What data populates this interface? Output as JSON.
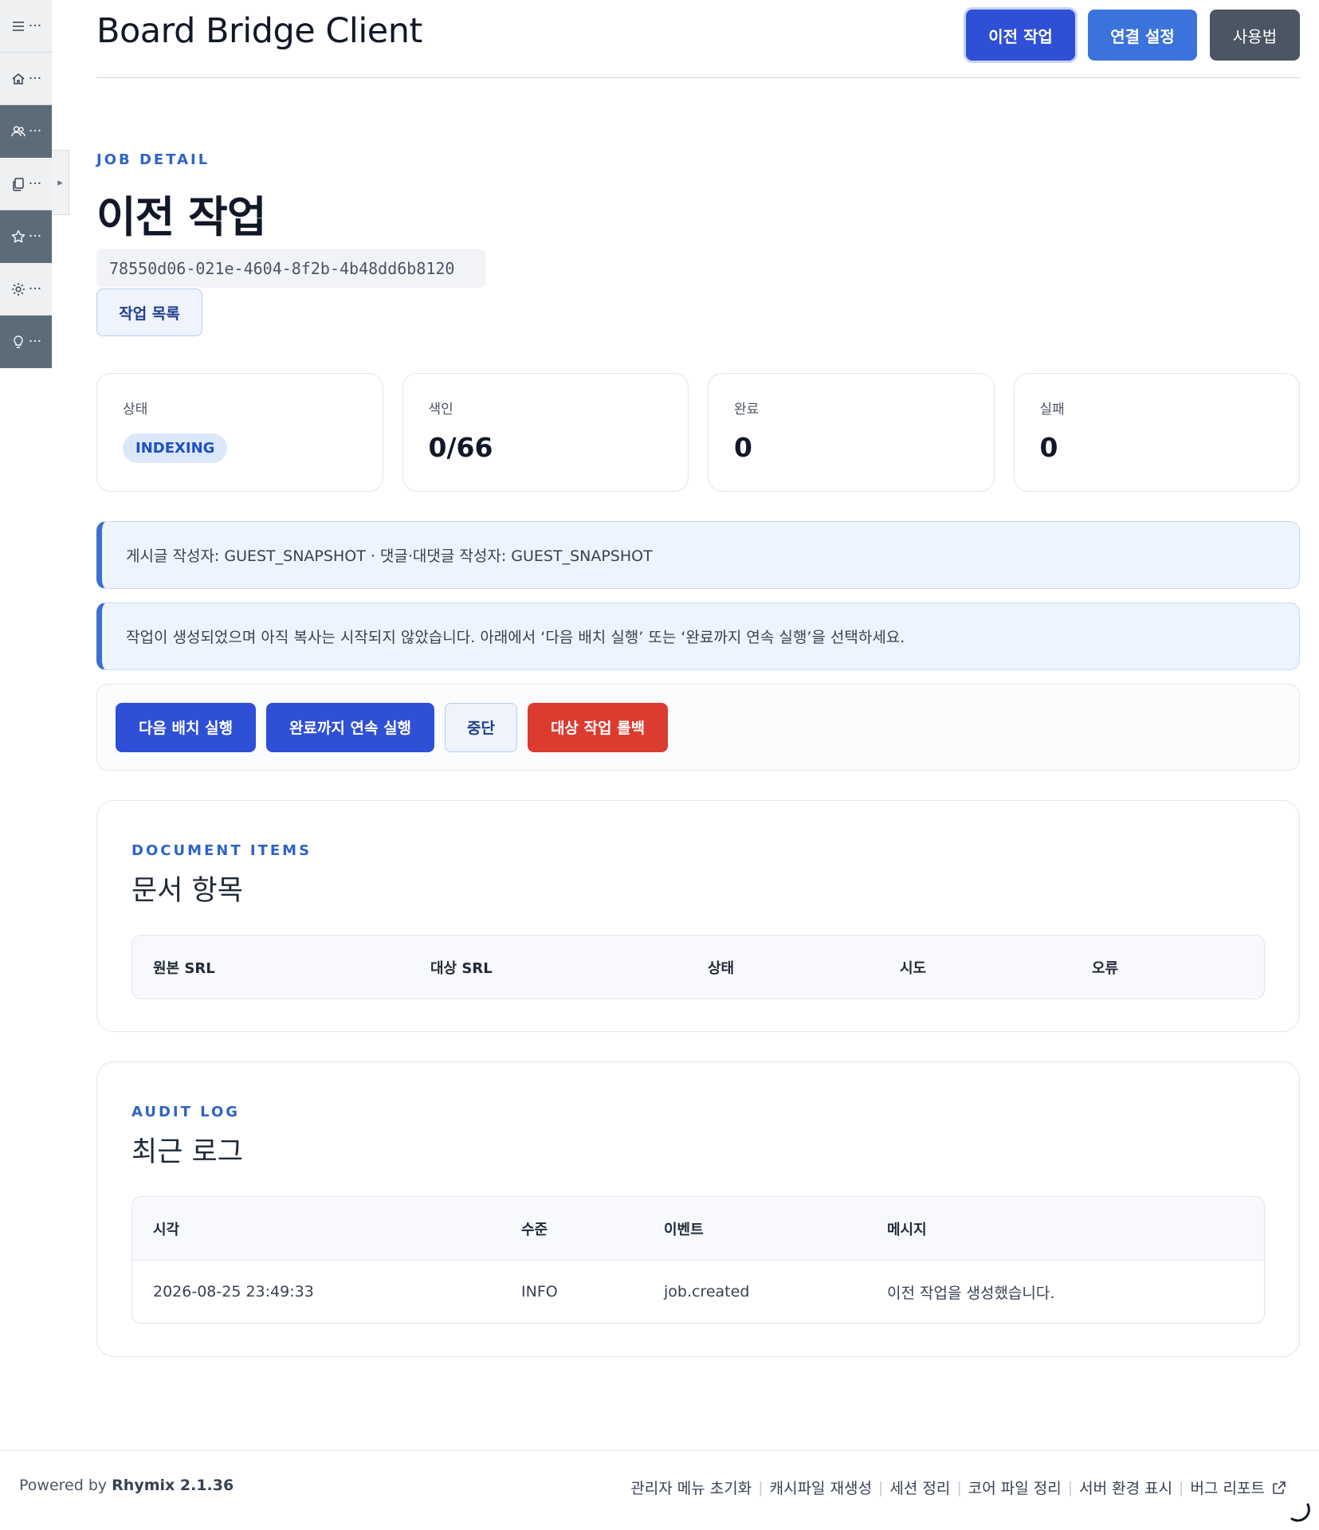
{
  "sidebar": {
    "items": [
      {
        "icon": "menu-icon",
        "more": "···"
      },
      {
        "icon": "home-icon",
        "more": "···"
      },
      {
        "icon": "users-icon",
        "more": "···"
      },
      {
        "icon": "documents-icon",
        "more": "···"
      },
      {
        "icon": "star-icon",
        "more": "···"
      },
      {
        "icon": "gear-icon",
        "more": "···"
      },
      {
        "icon": "lightbulb-icon",
        "more": "···"
      }
    ],
    "toggle": "▸"
  },
  "header": {
    "title": "Board Bridge Client",
    "nav": [
      "이전 작업",
      "연결 설정",
      "사용법"
    ]
  },
  "job": {
    "eyebrow": "JOB DETAIL",
    "title": "이전 작업",
    "id": "78550d06-021e-4604-8f2b-4b48dd6b8120",
    "list_button": "작업 목록"
  },
  "stats": [
    {
      "label": "상태",
      "badge": "INDEXING"
    },
    {
      "label": "색인",
      "value": "0/66"
    },
    {
      "label": "완료",
      "value": "0"
    },
    {
      "label": "실패",
      "value": "0"
    }
  ],
  "notices": [
    "게시글 작성자: GUEST_SNAPSHOT · 댓글·대댓글 작성자: GUEST_SNAPSHOT",
    "작업이 생성되었으며 아직 복사는 시작되지 않았습니다. 아래에서 ‘다음 배치 실행’ 또는 ‘완료까지 연속 실행’을 선택하세요."
  ],
  "actions": [
    "다음 배치 실행",
    "완료까지 연속 실행",
    "중단",
    "대상 작업 롤백"
  ],
  "documents": {
    "eyebrow": "DOCUMENT ITEMS",
    "title": "문서 항목",
    "columns": [
      "원본 SRL",
      "대상 SRL",
      "상태",
      "시도",
      "오류"
    ]
  },
  "audit": {
    "eyebrow": "AUDIT LOG",
    "title": "최근 로그",
    "columns": [
      "시각",
      "수준",
      "이벤트",
      "메시지"
    ],
    "rows": [
      [
        "2026-08-25 23:49:33",
        "INFO",
        "job.created",
        "이전 작업을 생성했습니다."
      ]
    ]
  },
  "footer": {
    "powered_prefix": "Powered by",
    "powered_name": "Rhymix 2.1.36",
    "links": [
      "관리자 메뉴 초기화",
      "캐시파일 재생성",
      "세션 정리",
      "코어 파일 정리",
      "서버 환경 표시",
      "버그 리포트"
    ],
    "separator": "|"
  }
}
